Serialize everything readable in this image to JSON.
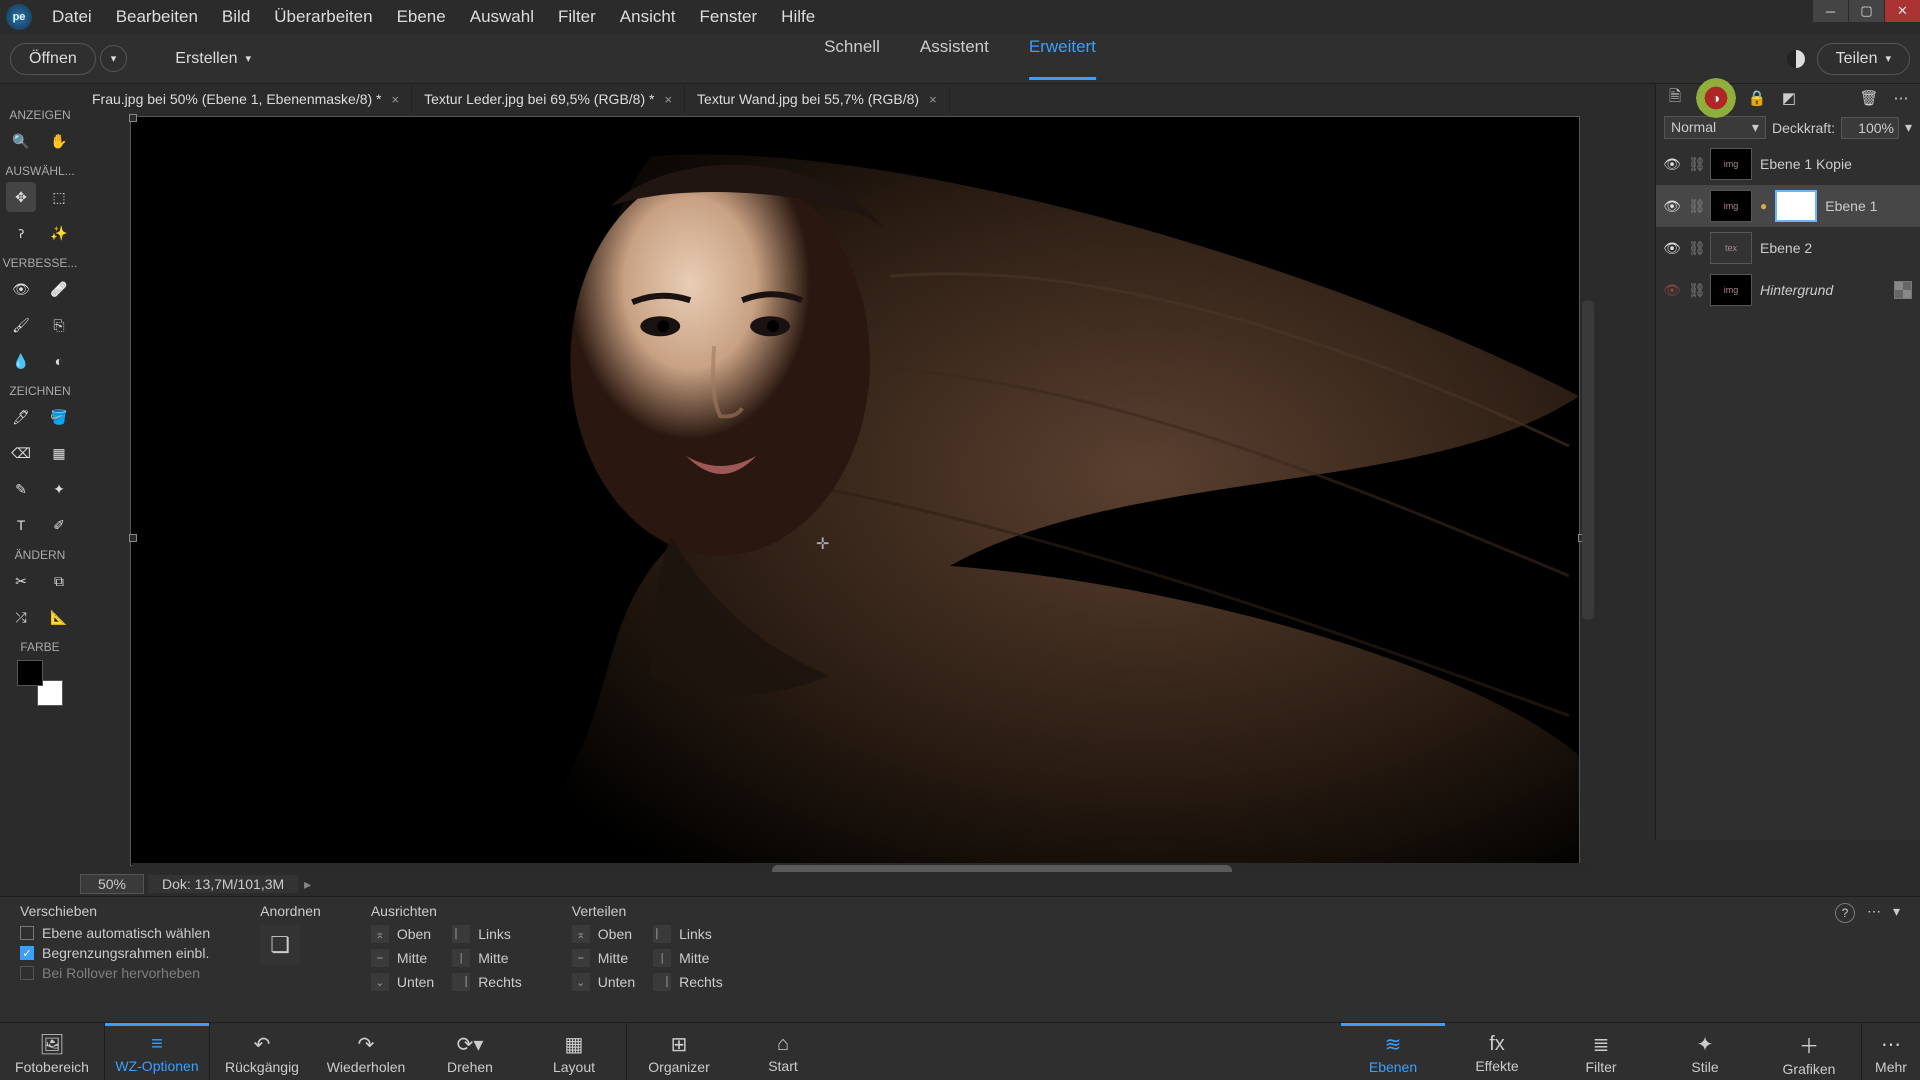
{
  "menu": [
    "Datei",
    "Bearbeiten",
    "Bild",
    "Überarbeiten",
    "Ebene",
    "Auswahl",
    "Filter",
    "Ansicht",
    "Fenster",
    "Hilfe"
  ],
  "secbar": {
    "open": "Öffnen",
    "create": "Erstellen",
    "share": "Teilen"
  },
  "modes": {
    "quick": "Schnell",
    "guided": "Assistent",
    "advanced": "Erweitert"
  },
  "docTabs": [
    {
      "label": "Frau.jpg bei 50% (Ebene 1, Ebenenmaske/8) *"
    },
    {
      "label": "Textur Leder.jpg bei 69,5% (RGB/8) *"
    },
    {
      "label": "Textur Wand.jpg bei 55,7% (RGB/8)"
    }
  ],
  "leftSections": {
    "view": "ANZEIGEN",
    "select": "AUSWÄHL...",
    "enhance": "VERBESSE...",
    "draw": "ZEICHNEN",
    "modify": "ÄNDERN",
    "color": "FARBE"
  },
  "status": {
    "zoom": "50%",
    "doc": "Dok: 13,7M/101,3M"
  },
  "toolopts": {
    "moveTitle": "Verschieben",
    "autoSelect": "Ebene automatisch wählen",
    "boundingBox": "Begrenzungsrahmen einbl.",
    "rollover": "Bei Rollover hervorheben",
    "arrange": "Anordnen",
    "align": "Ausrichten",
    "distribute": "Verteilen",
    "top": "Oben",
    "middle": "Mitte",
    "bottom": "Unten",
    "left": "Links",
    "centerH": "Mitte",
    "right": "Rechts"
  },
  "bottom": {
    "photoBin": "Fotobereich",
    "toolOptions": "WZ-Optionen",
    "undo": "Rückgängig",
    "redo": "Wiederholen",
    "rotate": "Drehen",
    "layout": "Layout",
    "organizer": "Organizer",
    "start": "Start",
    "layers": "Ebenen",
    "effects": "Effekte",
    "filters": "Filter",
    "styles": "Stile",
    "graphics": "Grafiken",
    "more": "Mehr"
  },
  "layersPanel": {
    "blendMode": "Normal",
    "opacityLabel": "Deckkraft:",
    "opacityValue": "100%",
    "layers": [
      {
        "name": "Ebene 1 Kopie",
        "visible": true
      },
      {
        "name": "Ebene 1",
        "visible": true,
        "selected": true,
        "masked": true,
        "linked": true
      },
      {
        "name": "Ebene 2",
        "visible": true
      },
      {
        "name": "Hintergrund",
        "visible": false,
        "italic": true,
        "locked": true
      }
    ]
  }
}
